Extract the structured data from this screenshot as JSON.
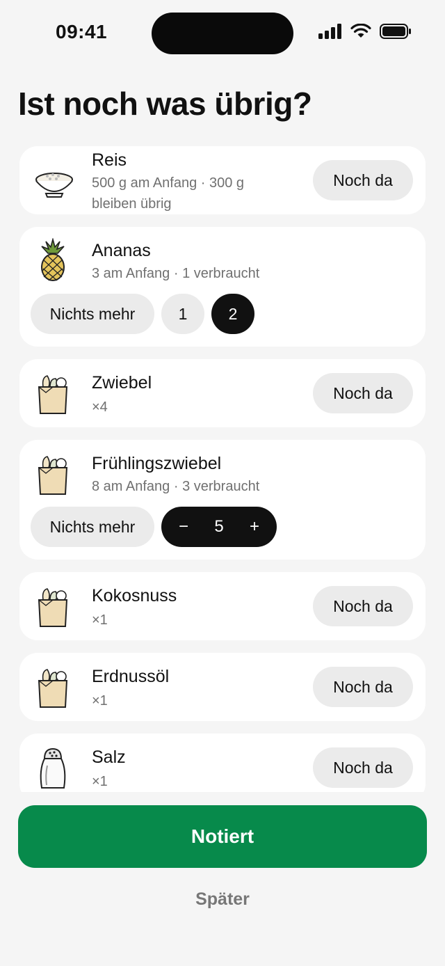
{
  "status": {
    "time": "09:41"
  },
  "header": {
    "title": "Ist noch was übrig?"
  },
  "items": [
    {
      "name": "Reis",
      "detail": "500 g am Anfang · 300 g bleiben übrig",
      "action": "Noch da",
      "icon": "rice-bowl-icon"
    },
    {
      "name": "Ananas",
      "detail": "3 am Anfang · 1 verbraucht",
      "icon": "pineapple-icon",
      "options": {
        "none": "Nichts mehr",
        "one": "1",
        "two": "2",
        "selected": "2"
      }
    },
    {
      "name": "Zwiebel",
      "detail": "×4",
      "action": "Noch da",
      "icon": "grocery-bag-icon"
    },
    {
      "name": "Frühlingszwiebel",
      "detail": "8 am Anfang · 3 verbraucht",
      "icon": "grocery-bag-icon",
      "options": {
        "none": "Nichts mehr",
        "minus": "−",
        "value": "5",
        "plus": "+"
      }
    },
    {
      "name": "Kokosnuss",
      "detail": "×1",
      "action": "Noch da",
      "icon": "grocery-bag-icon"
    },
    {
      "name": "Erdnussöl",
      "detail": "×1",
      "action": "Noch da",
      "icon": "grocery-bag-icon"
    },
    {
      "name": "Salz",
      "detail": "×1",
      "action": "Noch da",
      "icon": "salt-shaker-icon"
    }
  ],
  "footer": {
    "primary": "Notiert",
    "secondary": "Später"
  },
  "colors": {
    "primary": "#078a4b",
    "card": "#ffffff",
    "background": "#f5f5f5"
  }
}
